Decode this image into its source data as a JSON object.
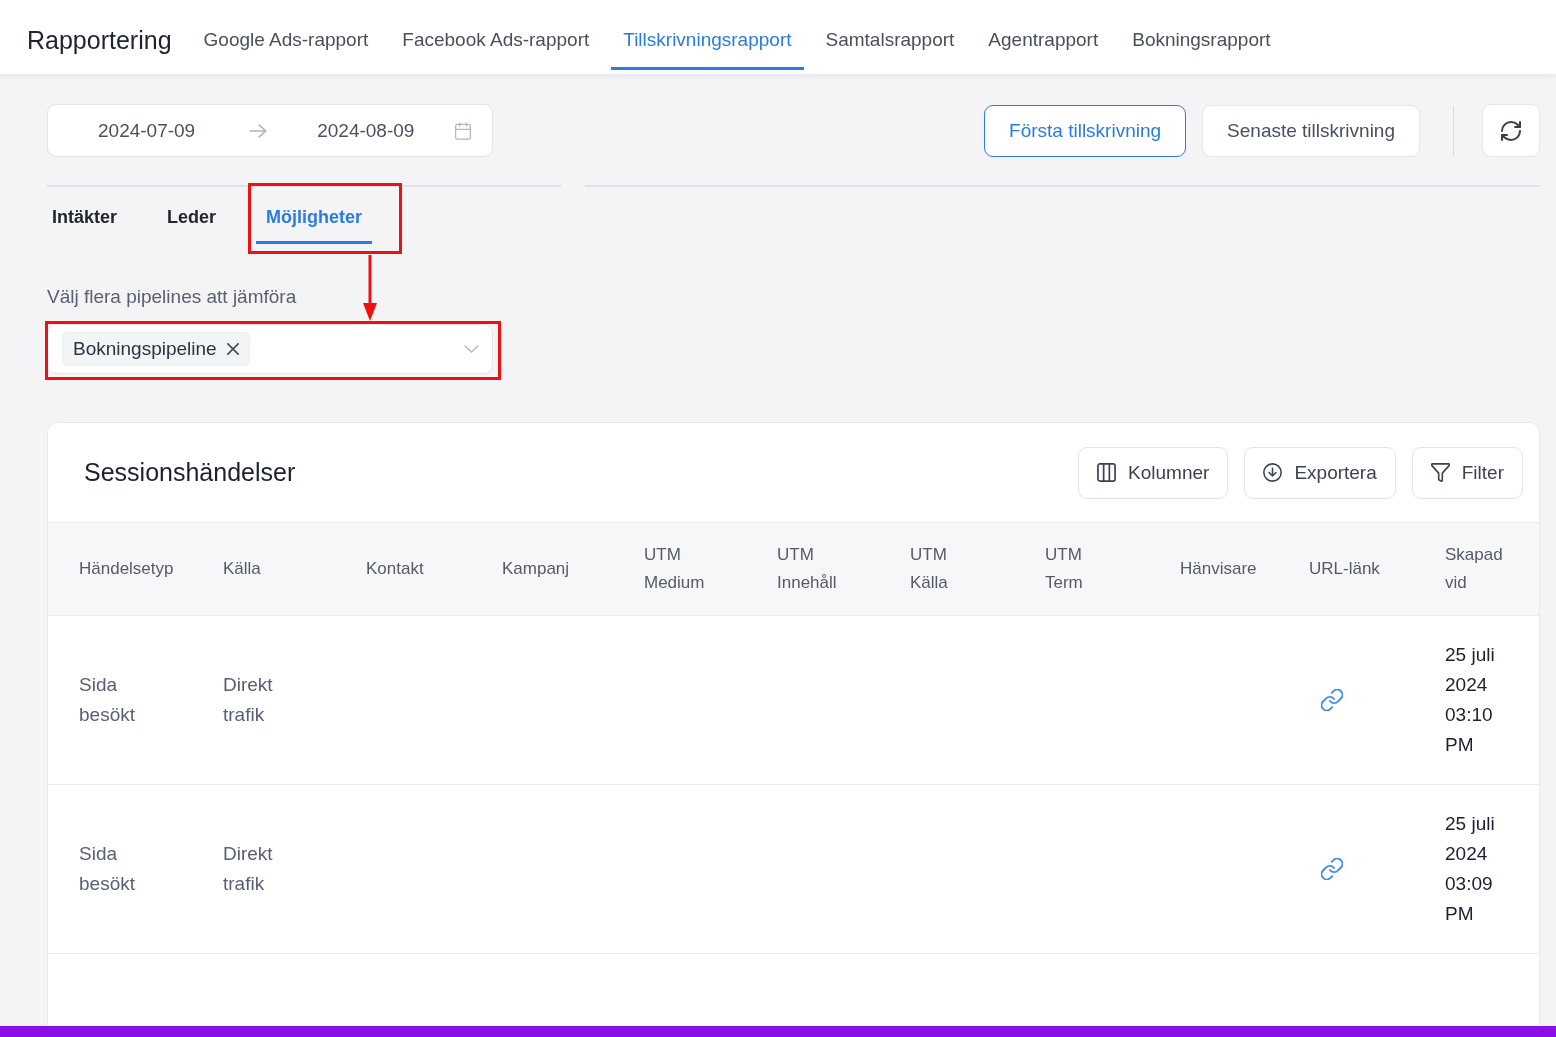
{
  "header": {
    "title": "Rapportering",
    "tabs": [
      {
        "label": "Google Ads-rapport",
        "selected": false
      },
      {
        "label": "Facebook Ads-rapport",
        "selected": false
      },
      {
        "label": "Tillskrivningsrapport",
        "selected": true
      },
      {
        "label": "Samtalsrapport",
        "selected": false
      },
      {
        "label": "Agentrapport",
        "selected": false
      },
      {
        "label": "Bokningsrapport",
        "selected": false
      }
    ]
  },
  "toolbar": {
    "date_range": {
      "start": "2024-07-09",
      "end": "2024-08-09"
    },
    "attribution_buttons": [
      {
        "label": "Första tillskrivning",
        "selected": true
      },
      {
        "label": "Senaste tillskrivning",
        "selected": false
      }
    ]
  },
  "section_tabs": [
    {
      "label": "Intäkter",
      "selected": false,
      "highlighted": false
    },
    {
      "label": "Leder",
      "selected": false,
      "highlighted": false
    },
    {
      "label": "Möjligheter",
      "selected": true,
      "highlighted": true
    }
  ],
  "pipeline_select": {
    "label": "Välj flera pipelines att jämföra",
    "tags": [
      "Bokningspipeline"
    ],
    "highlighted": true,
    "arrow": true
  },
  "session_events": {
    "title": "Sessionshändelser",
    "actions": [
      {
        "label": "Kolumner",
        "kind": "columns"
      },
      {
        "label": "Exportera",
        "kind": "export"
      },
      {
        "label": "Filter",
        "kind": "filter"
      }
    ],
    "table": {
      "columns": [
        "Händelsetyp",
        "Källa",
        "Kontakt",
        "Kampanj",
        "UTM Medium",
        "UTM Innehåll",
        "UTM Källa",
        "UTM Term",
        "Hänvisare",
        "URL-länk",
        "Skapad vid"
      ],
      "rows": [
        {
          "event_type": "Sida besökt",
          "source": "Direkt trafik",
          "url_link": true,
          "created_at": "25 juli 2024 03:10 PM"
        },
        {
          "event_type": "Sida besökt",
          "source": "Direkt trafik",
          "url_link": true,
          "created_at": "25 juli 2024 03:09 PM"
        }
      ]
    }
  }
}
